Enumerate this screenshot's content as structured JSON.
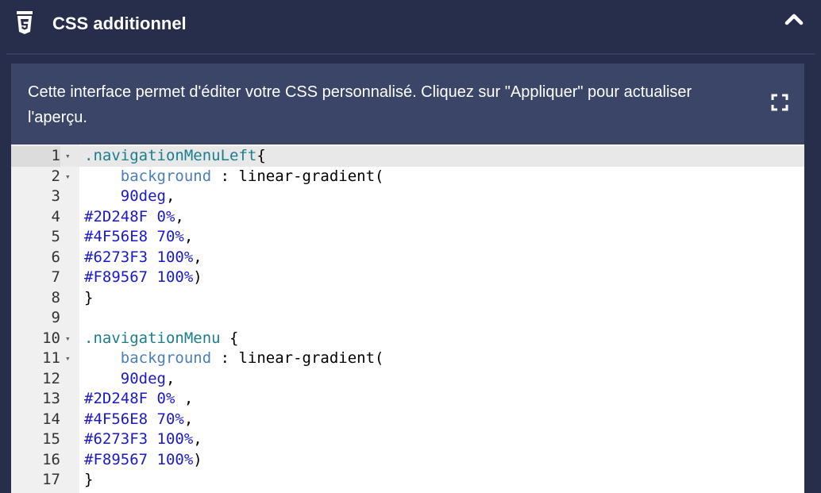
{
  "header": {
    "title": "CSS additionnel",
    "icon": "css3-icon",
    "collapse_icon": "chevron-up-icon"
  },
  "description": {
    "text": "Cette interface permet d'éditer votre CSS personnalisé. Cliquez sur \"Appliquer\" pour actualiser l'aperçu.",
    "fullscreen_icon": "fullscreen-icon"
  },
  "editor": {
    "lines": [
      {
        "n": "1",
        "fold": true,
        "active": true,
        "tokens": [
          {
            "c": "t-sel",
            "t": ".navigationMenuLeft"
          },
          {
            "c": "t-plain",
            "t": "{"
          }
        ]
      },
      {
        "n": "2",
        "fold": true,
        "tokens": [
          {
            "c": "t-plain",
            "t": "    "
          },
          {
            "c": "t-prop",
            "t": "background"
          },
          {
            "c": "t-plain",
            "t": " : linear-gradient("
          }
        ]
      },
      {
        "n": "3",
        "tokens": [
          {
            "c": "t-plain",
            "t": "    "
          },
          {
            "c": "t-num",
            "t": "90deg"
          },
          {
            "c": "t-plain",
            "t": ","
          }
        ]
      },
      {
        "n": "4",
        "tokens": [
          {
            "c": "t-num",
            "t": "#2D248F 0%"
          },
          {
            "c": "t-plain",
            "t": ","
          }
        ]
      },
      {
        "n": "5",
        "tokens": [
          {
            "c": "t-num",
            "t": "#4F56E8 70%"
          },
          {
            "c": "t-plain",
            "t": ","
          }
        ]
      },
      {
        "n": "6",
        "tokens": [
          {
            "c": "t-num",
            "t": "#6273F3 100%"
          },
          {
            "c": "t-plain",
            "t": ","
          }
        ]
      },
      {
        "n": "7",
        "tokens": [
          {
            "c": "t-num",
            "t": "#F89567 100%"
          },
          {
            "c": "t-plain",
            "t": ")"
          }
        ]
      },
      {
        "n": "8",
        "tokens": [
          {
            "c": "t-plain",
            "t": "}"
          }
        ]
      },
      {
        "n": "9",
        "tokens": []
      },
      {
        "n": "10",
        "fold": true,
        "tokens": [
          {
            "c": "t-sel",
            "t": ".navigationMenu"
          },
          {
            "c": "t-plain",
            "t": " {"
          }
        ]
      },
      {
        "n": "11",
        "fold": true,
        "tokens": [
          {
            "c": "t-plain",
            "t": "    "
          },
          {
            "c": "t-prop",
            "t": "background"
          },
          {
            "c": "t-plain",
            "t": " : linear-gradient("
          }
        ]
      },
      {
        "n": "12",
        "tokens": [
          {
            "c": "t-plain",
            "t": "    "
          },
          {
            "c": "t-num",
            "t": "90deg"
          },
          {
            "c": "t-plain",
            "t": ","
          }
        ]
      },
      {
        "n": "13",
        "tokens": [
          {
            "c": "t-num",
            "t": "#2D248F 0%"
          },
          {
            "c": "t-plain",
            "t": " ,"
          }
        ]
      },
      {
        "n": "14",
        "tokens": [
          {
            "c": "t-num",
            "t": "#4F56E8 70%"
          },
          {
            "c": "t-plain",
            "t": ","
          }
        ]
      },
      {
        "n": "15",
        "tokens": [
          {
            "c": "t-num",
            "t": "#6273F3 100%"
          },
          {
            "c": "t-plain",
            "t": ","
          }
        ]
      },
      {
        "n": "16",
        "tokens": [
          {
            "c": "t-num",
            "t": "#F89567 100%"
          },
          {
            "c": "t-plain",
            "t": ")"
          }
        ]
      },
      {
        "n": "17",
        "tokens": [
          {
            "c": "t-plain",
            "t": "}"
          }
        ]
      }
    ]
  },
  "colors": {
    "panel_bg": "#262e4c",
    "card_bg": "#3a4567",
    "selector": "#1b7e8d",
    "property": "#4a7fb8",
    "value": "#1a1acb"
  }
}
